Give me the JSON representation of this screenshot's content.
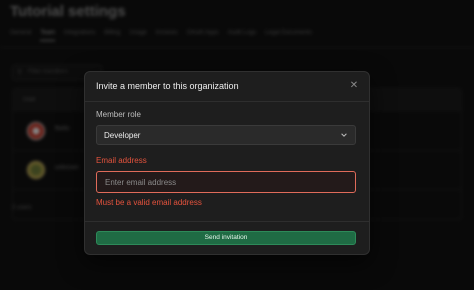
{
  "background": {
    "title": "Tutorial settings",
    "tabs": [
      "General",
      "Team",
      "Integrations",
      "Billing",
      "Usage",
      "Invoices",
      "OAuth Apps",
      "Audit Logs",
      "Legal Documents"
    ],
    "search_placeholder": "Filter members",
    "table_header": "User",
    "rows": [
      {
        "name": "fbello",
        "avatar_color": "#c0392b"
      },
      {
        "name": "unknown",
        "avatar_color": "#b8a040"
      }
    ],
    "count": "2 users"
  },
  "modal": {
    "title": "Invite a member to this organization",
    "role_label": "Member role",
    "role_value": "Developer",
    "email_label": "Email address",
    "email_placeholder": "Enter email address",
    "email_value": "",
    "email_error": "Must be a valid email address",
    "submit_label": "Send invitation"
  },
  "colors": {
    "error": "#e5533d",
    "primary": "#1f6b44",
    "surface": "#1e1e1e"
  }
}
